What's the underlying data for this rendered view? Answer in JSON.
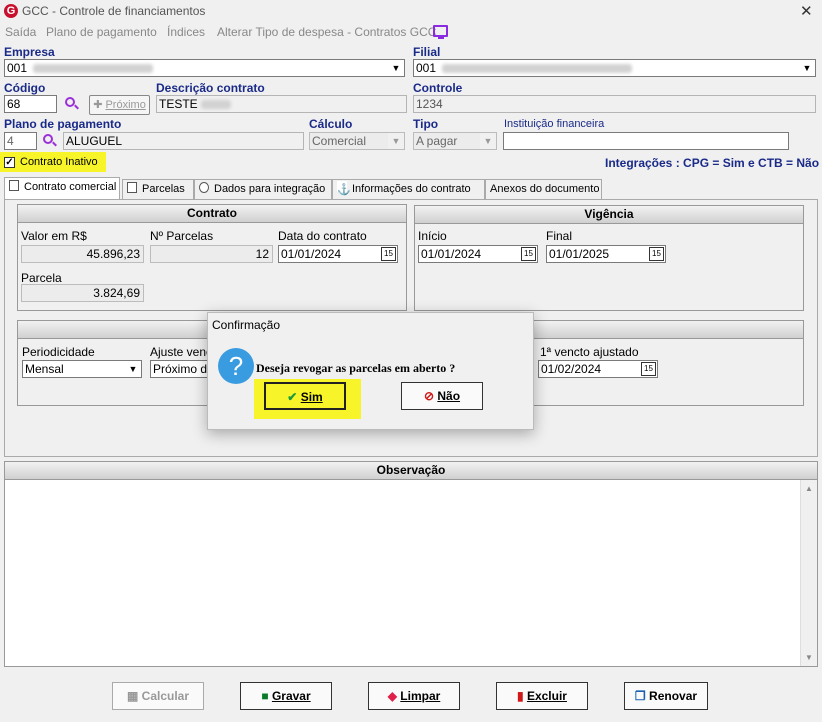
{
  "window": {
    "title": "GCC - Controle de financiamentos",
    "app_icon_letter": "G",
    "close": "✕"
  },
  "menu": [
    "Saída",
    "Plano de pagamento",
    "Índices",
    "Alterar Tipo de despesa - Contratos GCC"
  ],
  "empresa": {
    "label": "Empresa",
    "value": "001"
  },
  "filial": {
    "label": "Filial",
    "value": "001"
  },
  "codigo": {
    "label": "Código",
    "value": "68",
    "proximo": "Próximo"
  },
  "descricao": {
    "label": "Descrição contrato",
    "value": "TESTE"
  },
  "controle": {
    "label": "Controle",
    "value": "1234"
  },
  "plano": {
    "label": "Plano de pagamento",
    "code": "4",
    "value": "ALUGUEL"
  },
  "calculo": {
    "label": "Cálculo",
    "value": "Comercial"
  },
  "tipo": {
    "label": "Tipo",
    "value": "A pagar"
  },
  "instituicao": {
    "label": "Instituição financeira",
    "value": ""
  },
  "contrato_inativo": {
    "label": "Contrato Inativo",
    "check": "✓"
  },
  "integracoes": "Integrações : CPG = Sim e CTB = Não",
  "tabs": [
    "Contrato comercial",
    "Parcelas",
    "Dados para integração",
    "Informações do contrato",
    "Anexos do documento"
  ],
  "contrato": {
    "title": "Contrato",
    "valor_label": "Valor em R$",
    "valor": "45.896,23",
    "nparcelas_label": "Nº Parcelas",
    "nparcelas": "12",
    "data_label": "Data do contrato",
    "data": "01/01/2024",
    "parcela_label": "Parcela",
    "parcela": "3.824,69"
  },
  "vigencia": {
    "title": "Vigência",
    "inicio_label": "Início",
    "inicio": "01/01/2024",
    "final_label": "Final",
    "final": "01/01/2025"
  },
  "periodo": {
    "periodicidade_label": "Periodicidade",
    "periodicidade": "Mensal",
    "ajuste_label": "Ajuste vencto",
    "ajuste": "Próximo dia",
    "venc_label": "1ª vencto ajustado",
    "venc": "01/02/2024"
  },
  "observacao": {
    "title": "Observação"
  },
  "buttons": {
    "calcular": "Calcular",
    "gravar": "Gravar",
    "limpar": "Limpar",
    "excluir": "Excluir",
    "renovar": "Renovar"
  },
  "dialog": {
    "title": "Confirmação",
    "message": "Deseja revogar as parcelas em aberto ?",
    "sim": "Sim",
    "nao": "Não",
    "icon": "?"
  },
  "colors": {
    "highlight": "#f7f52a",
    "label_blue": "#1a2a88",
    "accent_purple": "#9b30d9"
  }
}
